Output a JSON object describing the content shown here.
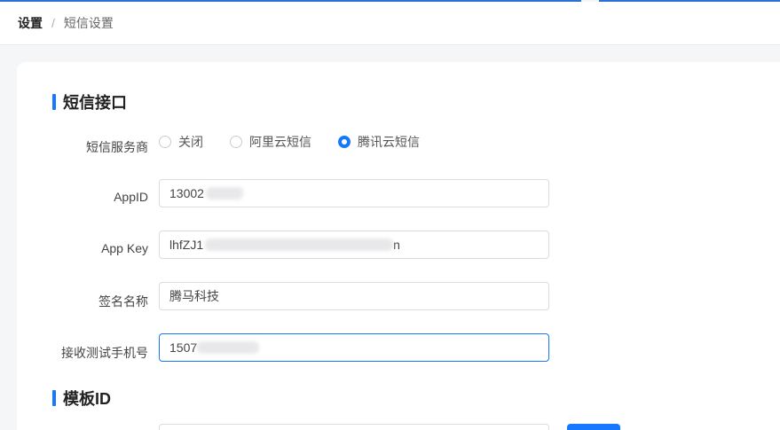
{
  "breadcrumb": {
    "root": "设置",
    "separator": "/",
    "current": "短信设置"
  },
  "sections": {
    "sms_interface": "短信接口",
    "template_id": "模板ID"
  },
  "form": {
    "provider_label": "短信服务商",
    "providers": [
      {
        "label": "关闭",
        "checked": false
      },
      {
        "label": "阿里云短信",
        "checked": false
      },
      {
        "label": "腾讯云短信",
        "checked": true
      }
    ],
    "appid_label": "AppID",
    "appid_value": "13002",
    "appkey_label": "App Key",
    "appkey_value_start": "lhfZJ1",
    "appkey_value_end": "n",
    "sign_label": "签名名称",
    "sign_value": "腾马科技",
    "phone_label": "接收测试手机号",
    "phone_value": "1507"
  },
  "colors": {
    "accent": "#1677ff",
    "top_line": "#2e6fd8"
  }
}
